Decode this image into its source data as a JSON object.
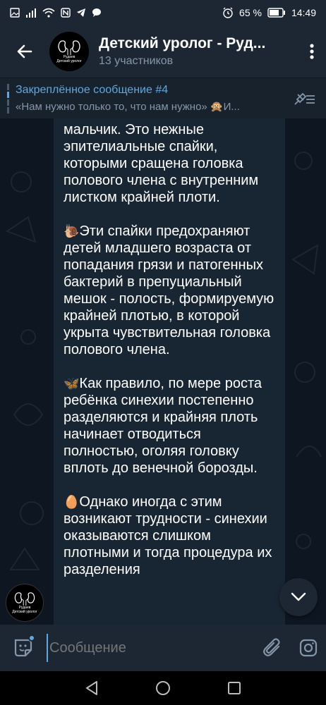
{
  "status_bar": {
    "battery": "65 %",
    "time": "14:49"
  },
  "header": {
    "title": "Детский уролог - Руд...",
    "subtitle": "13 участников",
    "avatar_text_1": "Рудаев",
    "avatar_text_2": "Детский уролог"
  },
  "pinned": {
    "title": "Закреплённое сообщение #4",
    "message": "«Нам нужно только то, что нам нужно» 🙊И..."
  },
  "message": {
    "paragraphs": [
      "мальчик. Это нежные эпителиальные спайки, которыми сращена головка полового члена с внутренним листком крайней плоти.",
      "Эти спайки предохраняют детей младшего возраста от попадания грязи и патогенных бактерий в препуциальный мешок - полость, формируемую крайней плотью, в которой укрыта чувствительная головка полового члена.",
      "Как правило, по мере роста ребёнка синехии постепенно разделяются и крайняя плоть начинает отводиться полностью, оголяя головку вплоть до венечной борозды.",
      "Однако иногда с этим возникают трудности - синехии оказываются слишком плотными и тогда процедура их разделения"
    ],
    "emojis": [
      "",
      "🐌",
      "🦋",
      "🥚"
    ]
  },
  "composer": {
    "placeholder": "Сообщение"
  },
  "colors": {
    "accent": "#5fa8e0",
    "header_bg": "#1d2733",
    "chat_bg": "#0e1621",
    "bubble_bg": "#182533"
  }
}
